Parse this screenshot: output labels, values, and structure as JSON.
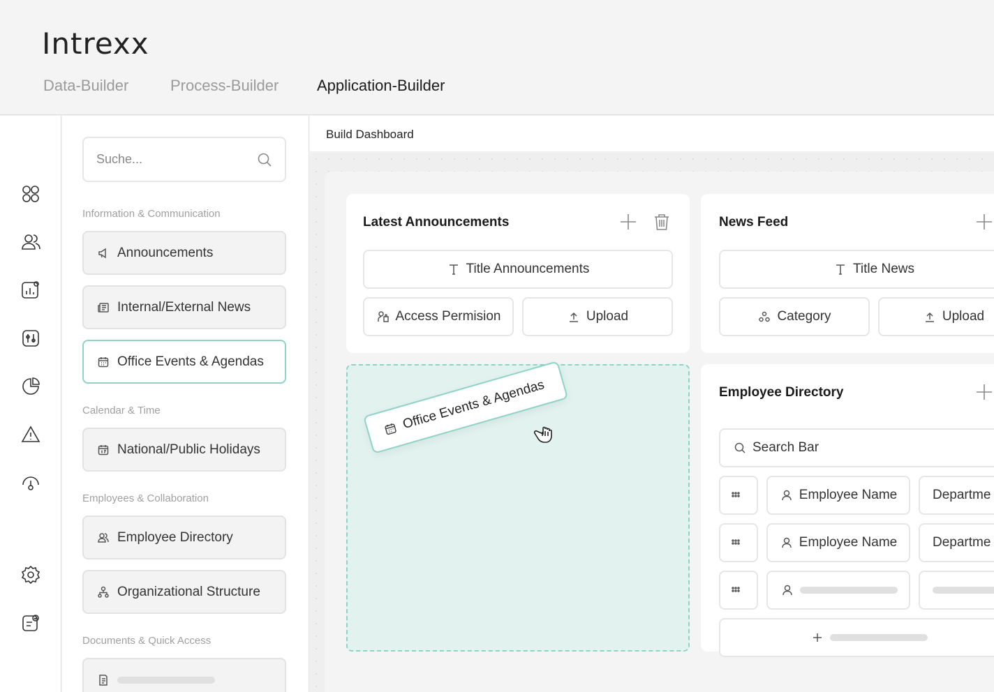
{
  "header": {
    "logo": "Intrexx",
    "tabs": [
      {
        "label": "Data-Builder",
        "active": false
      },
      {
        "label": "Process-Builder",
        "active": false
      },
      {
        "label": "Application-Builder",
        "active": true
      }
    ]
  },
  "rail": {
    "icons": [
      "apps-grid-icon",
      "users-icon",
      "analytics-icon",
      "settings-sliders-icon",
      "pie-chart-icon",
      "warning-icon",
      "gauge-icon",
      "gear-icon",
      "clipboard-check-icon"
    ]
  },
  "library": {
    "search_placeholder": "Suche...",
    "sections": [
      {
        "title": "Information & Communication",
        "items": [
          {
            "label": "Announcements",
            "icon": "megaphone-icon"
          },
          {
            "label": "Internal/External News",
            "icon": "newspaper-icon"
          },
          {
            "label": "Office Events & Agendas",
            "icon": "calendar-icon",
            "selected": true
          }
        ]
      },
      {
        "title": "Calendar & Time",
        "items": [
          {
            "label": "National/Public Holidays",
            "icon": "calendar-17-icon"
          }
        ]
      },
      {
        "title": "Employees & Collaboration",
        "items": [
          {
            "label": "Employee Directory",
            "icon": "users-icon"
          },
          {
            "label": "Organizational Structure",
            "icon": "org-chart-icon"
          }
        ]
      },
      {
        "title": "Documents & Quick Access",
        "items": [
          {
            "label": "",
            "icon": "document-icon"
          }
        ]
      }
    ]
  },
  "canvas": {
    "title": "Build Dashboard",
    "cards": {
      "announcements": {
        "title": "Latest Announcements",
        "fields": [
          "Title Announcements",
          "Access Permision",
          "Upload"
        ]
      },
      "news": {
        "title": "News Feed",
        "fields": [
          "Title News",
          "Category",
          "Upload"
        ]
      },
      "directory": {
        "title": "Employee Directory",
        "search": "Search Bar",
        "rows": [
          {
            "name": "Employee Name",
            "dept": "Departme"
          },
          {
            "name": "Employee Name",
            "dept": "Departme"
          }
        ]
      }
    },
    "dragged_item": "Office Events & Agendas"
  },
  "colors": {
    "accent": "#8ed3c7",
    "dropzone_bg": "#e1f2ef"
  }
}
